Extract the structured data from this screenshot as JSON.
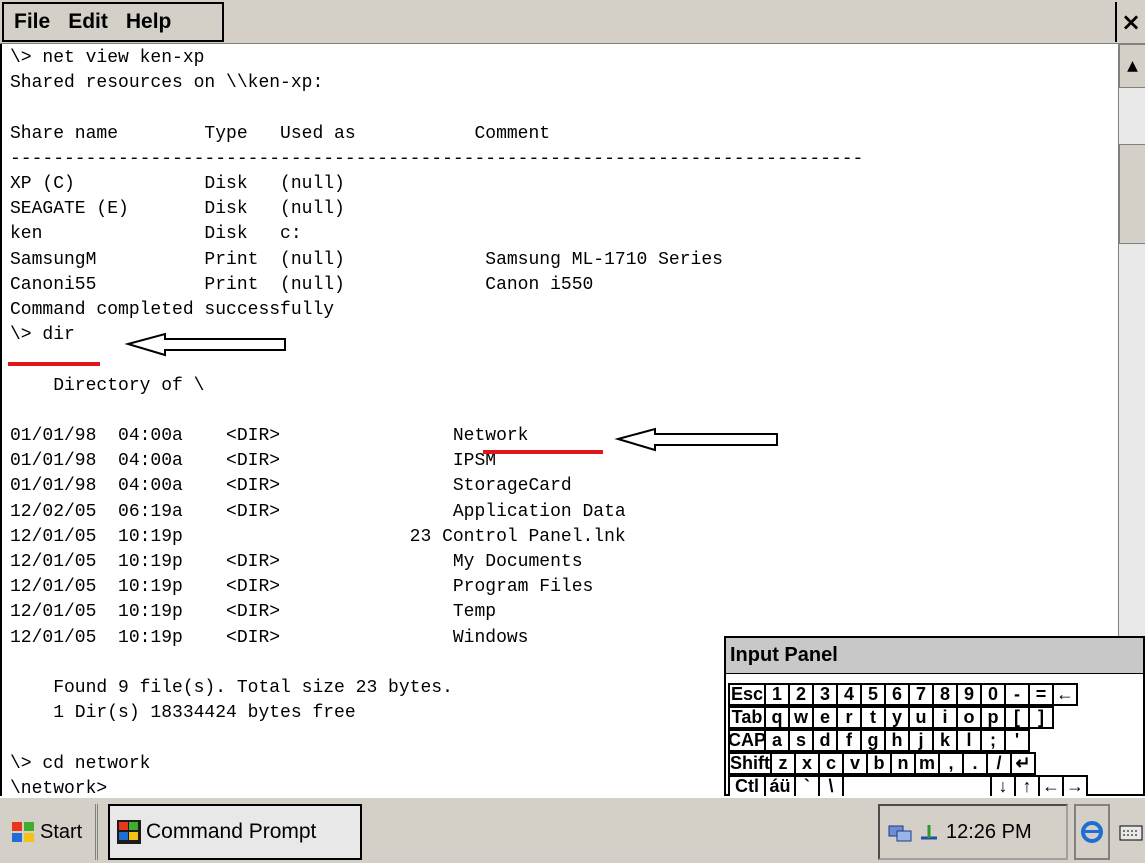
{
  "menu": {
    "file": "File",
    "edit": "Edit",
    "help": "Help",
    "close_glyph": "×"
  },
  "console": {
    "lines": [
      "\\> net view ken-xp",
      "Shared resources on \\\\ken-xp:",
      "",
      "Share name        Type   Used as           Comment",
      "-------------------------------------------------------------------------------",
      "XP (C)            Disk   (null)",
      "SEAGATE (E)       Disk   (null)",
      "ken               Disk   c:",
      "SamsungM          Print  (null)             Samsung ML-1710 Series",
      "Canoni55          Print  (null)             Canon i550",
      "Command completed successfully",
      "\\> dir",
      "",
      "    Directory of \\",
      "",
      "01/01/98  04:00a    <DIR>                Network",
      "01/01/98  04:00a    <DIR>                IPSM",
      "01/01/98  04:00a    <DIR>                StorageCard",
      "12/02/05  06:19a    <DIR>                Application Data",
      "12/01/05  10:19p                     23 Control Panel.lnk",
      "12/01/05  10:19p    <DIR>                My Documents",
      "12/01/05  10:19p    <DIR>                Program Files",
      "12/01/05  10:19p    <DIR>                Temp",
      "12/01/05  10:19p    <DIR>                Windows",
      "",
      "    Found 9 file(s). Total size 23 bytes.",
      "    1 Dir(s) 18334424 bytes free",
      "",
      "\\> cd network",
      "\\network>"
    ]
  },
  "scrollbar": {
    "up_glyph": "▲"
  },
  "input_panel": {
    "title": "Input Panel",
    "rows": [
      [
        "Esc",
        "1",
        "2",
        "3",
        "4",
        "5",
        "6",
        "7",
        "8",
        "9",
        "0",
        "-",
        "=",
        "←"
      ],
      [
        "Tab",
        "q",
        "w",
        "e",
        "r",
        "t",
        "y",
        "u",
        "i",
        "o",
        "p",
        "[",
        "]"
      ],
      [
        "CAP",
        "a",
        "s",
        "d",
        "f",
        "g",
        "h",
        "j",
        "k",
        "l",
        ";",
        "'"
      ],
      [
        "Shift",
        "z",
        "x",
        "c",
        "v",
        "b",
        "n",
        "m",
        ",",
        ".",
        "/",
        "↵"
      ],
      [
        "Ctl",
        "áü",
        "`",
        "\\",
        "",
        "↓",
        "↑",
        "←",
        "→"
      ]
    ]
  },
  "taskbar": {
    "start_label": "Start",
    "task_label": "Command Prompt",
    "clock": "12:26 PM"
  },
  "colors": {
    "annotation_red": "#e0161c",
    "window_gray": "#d4d0c8"
  }
}
